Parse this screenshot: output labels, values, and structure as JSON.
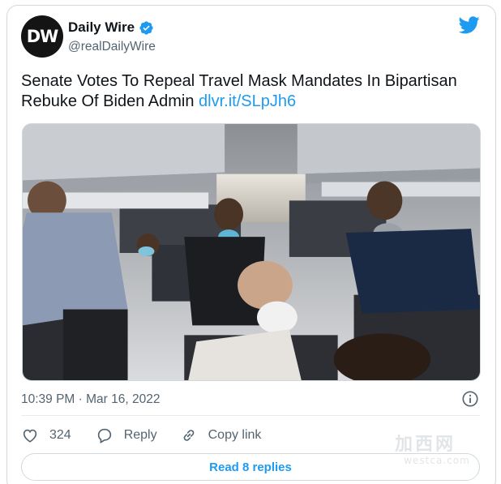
{
  "author": {
    "avatar_text": "DW",
    "display_name": "Daily Wire",
    "handle": "@realDailyWire"
  },
  "tweet": {
    "text": "Senate Votes To Repeal Travel Mask Mandates In Bipartisan Rebuke Of Biden Admin ",
    "link": "dlvr.it/SLpJh6"
  },
  "meta": {
    "timestamp": "10:39 PM · Mar 16, 2022"
  },
  "actions": {
    "like_count": "324",
    "reply_label": "Reply",
    "copy_link_label": "Copy link"
  },
  "read_replies_label": "Read 8 replies",
  "watermark": {
    "top": "加西网",
    "bottom": "westca.com"
  },
  "colors": {
    "accent": "#1d9bf0",
    "secondary_text": "#536471",
    "border": "#cfd9de"
  },
  "icons": [
    "verified-badge-icon",
    "twitter-bird-icon",
    "info-icon",
    "heart-icon",
    "reply-bubble-icon",
    "link-chain-icon"
  ]
}
